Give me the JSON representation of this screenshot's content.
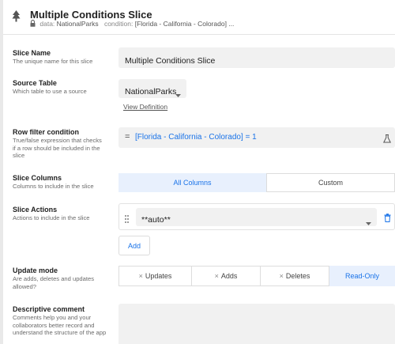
{
  "header": {
    "title": "Multiple Conditions Slice",
    "data_label": "data:",
    "data_value": "NationalParks",
    "condition_label": "condition:",
    "condition_value": "[Florida - California - Colorado] ..."
  },
  "slice_name": {
    "label": "Slice Name",
    "description": "The unique name for this slice",
    "value": "Multiple Conditions Slice"
  },
  "source_table": {
    "label": "Source Table",
    "description": "Which table to use a source",
    "value": "NationalParks",
    "link": "View Definition"
  },
  "row_filter": {
    "label": "Row filter condition",
    "description_lines": [
      "True/false expression that checks",
      "if a row should be included in the",
      "slice"
    ],
    "prefix": "=",
    "expr_column": "[Florida - California - Colorado]",
    "expr_rest": " = 1"
  },
  "slice_columns": {
    "label": "Slice Columns",
    "description": "Columns to include in the slice",
    "options": [
      "All Columns",
      "Custom"
    ],
    "selected": "All Columns"
  },
  "slice_actions": {
    "label": "Slice Actions",
    "description": "Actions to include in the slice",
    "value": "**auto**",
    "add_label": "Add"
  },
  "update_mode": {
    "label": "Update mode",
    "description_lines": [
      "Are adds, deletes and updates",
      "allowed?"
    ],
    "options": [
      "Updates",
      "Adds",
      "Deletes",
      "Read-Only"
    ],
    "selected": "Read-Only"
  },
  "comment": {
    "label": "Descriptive comment",
    "description_lines": [
      "Comments help you and your",
      "collaborators better record and",
      "understand the structure of the app"
    ],
    "value": ""
  },
  "colors": {
    "accent": "#1a73e8",
    "selected_bg": "#e8f0fd",
    "field_bg": "#f1f1f1"
  }
}
